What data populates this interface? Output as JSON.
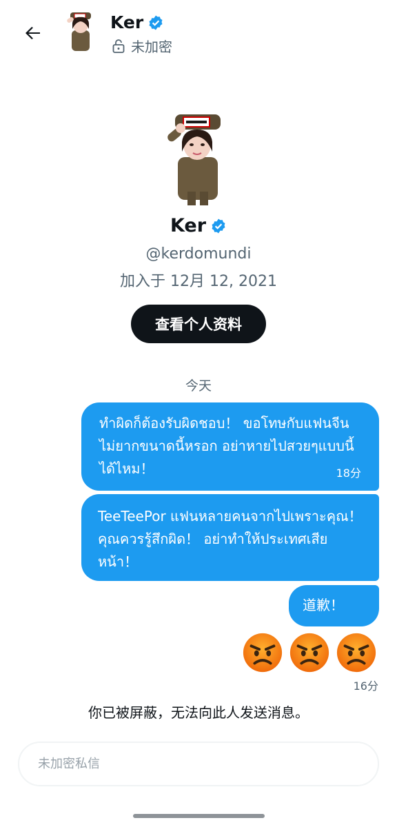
{
  "header": {
    "name": "Ker",
    "encryption_status": "未加密",
    "icons": {
      "back": "arrow-left-icon",
      "verified": "verified-badge-icon",
      "lock": "unlock-icon"
    }
  },
  "profile": {
    "name": "Ker",
    "handle": "@kerdomundi",
    "joined": "加入于 12月 12, 2021",
    "view_profile_label": "查看个人资料"
  },
  "chat": {
    "day_label": "今天",
    "messages": [
      {
        "text": "ทำผิดก็ต้องรับผิดชอบ！ ขอโทษกับแฟนจีนไม่ยากขนาดนี้หรอก อย่าหายไปสวยๆแบบนี้ได้ไหม！",
        "time": "18分"
      },
      {
        "text": "TeeTeePor แฟนหลายคนจากไปเพราะคุณ！ คุณควรรู้สึกผิด！ อย่าทำให้ประเทศเสียหน้า！"
      },
      {
        "text": "道歉！"
      }
    ],
    "emoji_message": {
      "emojis": [
        "angry-face",
        "angry-face",
        "angry-face"
      ],
      "time": "16分"
    },
    "blocked_notice": "你已被屏蔽，无法向此人发送消息。"
  },
  "composer": {
    "placeholder": "未加密私信"
  },
  "colors": {
    "accent": "#1d9bf0",
    "text": "#0f1419",
    "muted": "#536471",
    "button_bg": "#0f1419"
  }
}
